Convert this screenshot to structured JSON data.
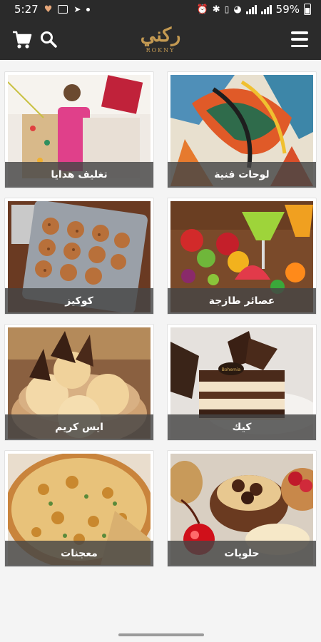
{
  "status_bar": {
    "time": "5:27",
    "battery": "59%",
    "left_icons": [
      "heart-icon",
      "laptop-icon",
      "telegram-icon",
      "dot-icon"
    ],
    "right_icons": [
      "alarm-icon",
      "bluetooth-icon",
      "vibrate-icon",
      "wifi-icon",
      "signal-icon",
      "signal-icon",
      "battery-icon"
    ]
  },
  "app_bar": {
    "logo_text": "ركني",
    "logo_subtext": "ROKNY",
    "brand_color": "#c49a52",
    "background": "#2b2b2b",
    "icons": [
      "cart-icon",
      "search-icon",
      "menu-icon"
    ]
  },
  "categories": [
    {
      "label": "لوحات فنية",
      "image": "paintings-image"
    },
    {
      "label": "تغليف هدايا",
      "image": "gift-wrapping-image"
    },
    {
      "label": "عصائر طازجة",
      "image": "fresh-juices-image"
    },
    {
      "label": "كوكيز",
      "image": "cookies-image"
    },
    {
      "label": "كيك",
      "image": "cake-image"
    },
    {
      "label": "ايس كريم",
      "image": "ice-cream-image"
    },
    {
      "label": "حلويات",
      "image": "sweets-image"
    },
    {
      "label": "معجنات",
      "image": "pastries-image"
    }
  ]
}
